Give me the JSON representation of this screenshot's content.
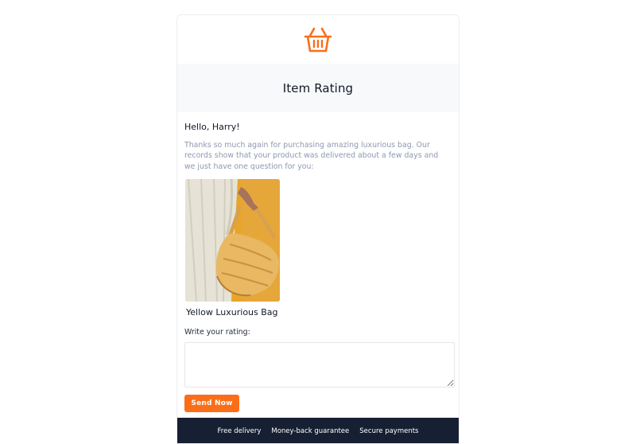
{
  "header": {
    "title": "Item Rating",
    "logo_icon": "shopping-basket-icon"
  },
  "message": {
    "greeting": "Hello, Harry!",
    "intro": "Thanks so much again for purchasing amazing luxurious bag. Our records show that your product was delivered about a few days and we just have one question for you:"
  },
  "product": {
    "name": "Yellow Luxurious Bag"
  },
  "rating": {
    "label": "Write your rating:",
    "value": ""
  },
  "actions": {
    "send_label": "Send Now"
  },
  "footer": {
    "links": [
      "Free delivery",
      "Money-back guarantee",
      "Secure payments"
    ]
  },
  "colors": {
    "accent": "#fb6e19",
    "footer_bg": "#172033",
    "muted_text": "#8e98b0"
  }
}
